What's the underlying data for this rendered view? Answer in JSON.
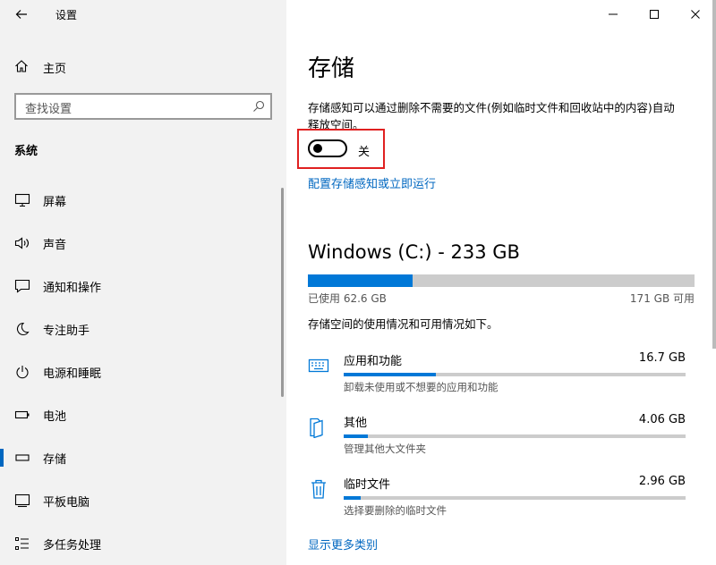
{
  "window": {
    "app_title": "设置",
    "back_icon": "arrow-left-icon",
    "minimize_icon": "minimize-icon",
    "maximize_icon": "maximize-icon",
    "close_icon": "close-icon"
  },
  "nav": {
    "home_label": "主页",
    "search_placeholder": "查找设置",
    "section_title": "系统",
    "items": [
      {
        "label": "屏幕",
        "icon": "monitor-icon"
      },
      {
        "label": "声音",
        "icon": "speaker-icon"
      },
      {
        "label": "通知和操作",
        "icon": "message-icon"
      },
      {
        "label": "专注助手",
        "icon": "moon-icon"
      },
      {
        "label": "电源和睡眠",
        "icon": "power-icon"
      },
      {
        "label": "电池",
        "icon": "battery-icon"
      },
      {
        "label": "存储",
        "icon": "drive-icon",
        "active": true
      },
      {
        "label": "平板电脑",
        "icon": "tablet-icon"
      },
      {
        "label": "多任务处理",
        "icon": "multitask-icon"
      }
    ]
  },
  "main": {
    "title": "存储",
    "description": "存储感知可以通过删除不需要的文件(例如临时文件和回收站中的内容)自动释放空间。",
    "toggle_state": "关",
    "toggle_on": false,
    "configure_link": "配置存储感知或立即运行",
    "drive": {
      "title": "Windows (C:) - 233 GB",
      "used_label": "已使用 62.6 GB",
      "available_label": "171 GB 可用",
      "used_fraction": 0.27
    },
    "usage_desc": "存储空间的使用情况和可用情况如下。",
    "categories": [
      {
        "name": "应用和功能",
        "size": "16.7 GB",
        "sub": "卸载未使用或不想要的应用和功能",
        "icon": "apps-keyboard-icon",
        "fraction": 0.27
      },
      {
        "name": "其他",
        "size": "4.06 GB",
        "sub": "管理其他大文件夹",
        "icon": "folder-icon",
        "fraction": 0.07
      },
      {
        "name": "临时文件",
        "size": "2.96 GB",
        "sub": "选择要删除的临时文件",
        "icon": "trash-icon",
        "fraction": 0.05
      }
    ],
    "more_link": "显示更多类别"
  },
  "colors": {
    "accent": "#0078d7",
    "link": "#0067c0",
    "highlight_frame": "#e02020",
    "nav_bg": "#f2f2f2"
  }
}
